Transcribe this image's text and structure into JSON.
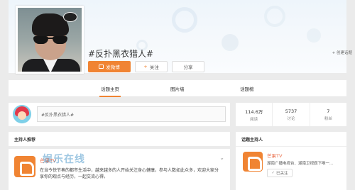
{
  "topic": {
    "title": "#反扑黑衣猎人#",
    "create_label": "+ 创建话题",
    "post_button": "发微博",
    "follow_button": "关注",
    "follow_icon": "+",
    "share_button": "分享"
  },
  "tabs": [
    {
      "label": "话题主页",
      "active": true
    },
    {
      "label": "图片墙",
      "active": false
    },
    {
      "label": "话题榜",
      "active": false
    }
  ],
  "post_box": {
    "placeholder": "#反扑黑衣猎人#"
  },
  "stats": [
    {
      "value": "114.6万",
      "label": "阅读"
    },
    {
      "value": "5737",
      "label": "讨论"
    },
    {
      "value": "7",
      "label": "粉丝"
    }
  ],
  "host_recommend": {
    "title": "主持人推荐"
  },
  "post": {
    "author": "芒果TV",
    "text": "在当今快节奏的都市生活中，越来越多的人开始关注身心健康，参与人数如此众多，欢迎大家分享你的观点与经历，一起交流心得。",
    "watermark": "娱乐在线"
  },
  "topic_host": {
    "header": "话题主持人",
    "name": "芒果TV",
    "description": "湖南广播电视台、湖南卫视旗下唯一...",
    "followed_label": "已关注",
    "followed_icon": "✓"
  },
  "colors": {
    "accent": "#f08433",
    "link": "#eb7350"
  }
}
